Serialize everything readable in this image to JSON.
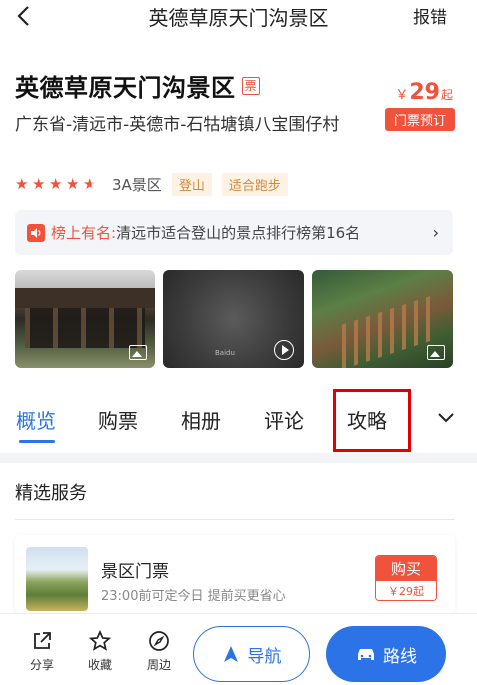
{
  "topbar": {
    "title": "英德草原天门沟景区",
    "report": "报错"
  },
  "header": {
    "name": "英德草原天门沟景区",
    "ticket_tag": "票",
    "price_currency": "￥",
    "price_value": "29",
    "price_suffix": "起",
    "book_label": "门票预订",
    "address": "广东省-清远市-英德市-石牯塘镇八宝围仔村",
    "rating_stars": 4.5,
    "level": "3A景区",
    "tags": [
      "登山",
      "适合跑步"
    ]
  },
  "rank": {
    "label": "榜上有名:",
    "text": "清远市适合登山的景点排行榜第16名",
    "arrow": "›"
  },
  "gallery": {
    "items": [
      {
        "type": "photo",
        "icon": "image-icon"
      },
      {
        "type": "video",
        "icon": "play-icon",
        "watermark": "Baidu"
      },
      {
        "type": "photo",
        "icon": "image-icon"
      }
    ]
  },
  "tabs": [
    "概览",
    "购票",
    "相册",
    "评论",
    "攻略"
  ],
  "active_tab": "概览",
  "section": {
    "title": "精选服务"
  },
  "service": {
    "name": "景区门票",
    "desc": "23:00前可定今日 提前买更省心",
    "buy_label": "购买",
    "buy_price": "￥29起"
  },
  "bottom": {
    "share": "分享",
    "favorite": "收藏",
    "nearby": "周边",
    "navigate": "导航",
    "route": "路线"
  },
  "colors": {
    "accent": "#2c73e8",
    "price": "#f1523c",
    "highlight": "#e00000"
  }
}
